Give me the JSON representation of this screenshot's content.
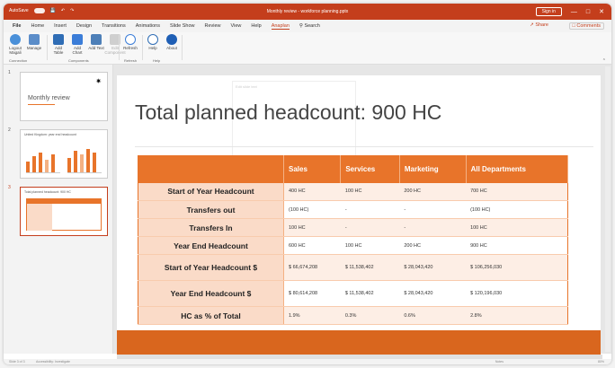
{
  "titlebar": {
    "autosave": "AutoSave",
    "doc_title": "Monthly review - workforce planning.pptx",
    "signin": "Sign in",
    "color": "#c43e1c"
  },
  "menu": {
    "file": "File",
    "tabs": [
      "Home",
      "Insert",
      "Design",
      "Transitions",
      "Animations",
      "Slide Show",
      "Review",
      "View",
      "Help",
      "Anaplan"
    ],
    "search": "Search",
    "share": "Share",
    "comments": "Comments"
  },
  "ribbon": {
    "groups": [
      {
        "name": "Connection",
        "buttons": [
          "Logout Magali",
          "Manage"
        ]
      },
      {
        "name": "Components",
        "buttons": [
          "Add Table",
          "Add Chart",
          "Add Text",
          "Edit Component"
        ]
      },
      {
        "name": "Refresh",
        "buttons": [
          "Refresh"
        ]
      },
      {
        "name": "Help",
        "buttons": [
          "Help",
          "About"
        ]
      }
    ]
  },
  "thumbnails": [
    {
      "num": "1",
      "title": "Monthly review"
    },
    {
      "num": "2",
      "title": "United Kingdom: year end headcount"
    },
    {
      "num": "3",
      "title": "Total planned headcount: 900 HC"
    }
  ],
  "slide": {
    "title": "Total planned headcount: 900 HC",
    "ghost_label": "Edit slide text",
    "accent": "#e8742a",
    "table": {
      "headers": [
        "",
        "Sales",
        "Services",
        "Marketing",
        "All Departments"
      ],
      "rows": [
        {
          "label": "Start of Year Headcount",
          "values": [
            "400 HC",
            "100 HC",
            "200 HC",
            "700 HC"
          ]
        },
        {
          "label": "Transfers out",
          "values": [
            "(100 HC)",
            "-",
            "-",
            "(100 HC)"
          ]
        },
        {
          "label": "Transfers In",
          "values": [
            "100 HC",
            "-",
            "-",
            "100 HC"
          ]
        },
        {
          "label": "Year End Headcount",
          "values": [
            "600 HC",
            "100 HC",
            "200 HC",
            "900 HC"
          ]
        },
        {
          "label": "Start of Year Headcount $",
          "values": [
            "$ 66,674,208",
            "$ 11,538,402",
            "$ 28,043,420",
            "$ 106,256,030"
          ]
        },
        {
          "label": "Year End Headcount $",
          "values": [
            "$ 80,614,208",
            "$ 11,538,402",
            "$ 28,043,420",
            "$ 120,196,030"
          ]
        },
        {
          "label": "HC as % of Total",
          "values": [
            "1.9%",
            "0.3%",
            "0.6%",
            "2.8%"
          ]
        }
      ]
    }
  },
  "statusbar": {
    "slide_info": "Slide 3 of 3",
    "accessibility": "Accessibility: Investigate",
    "notes": "Notes",
    "zoom": "80%"
  }
}
